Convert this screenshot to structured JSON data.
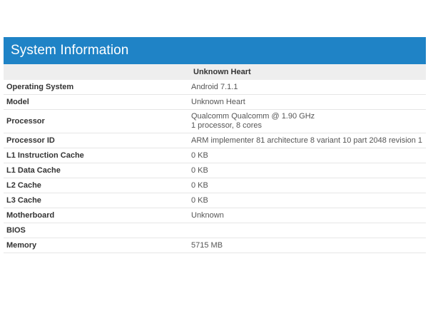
{
  "header": {
    "title": "System Information"
  },
  "device": {
    "name": "Unknown Heart"
  },
  "rows": [
    {
      "key": "Operating System",
      "value": "Android 7.1.1"
    },
    {
      "key": "Model",
      "value": "Unknown Heart"
    },
    {
      "key": "Processor",
      "value": "Qualcomm Qualcomm @ 1.90 GHz",
      "value2": "1 processor, 8 cores"
    },
    {
      "key": "Processor ID",
      "value": "ARM implementer 81 architecture 8 variant 10 part 2048 revision 1"
    },
    {
      "key": "L1 Instruction Cache",
      "value": "0 KB"
    },
    {
      "key": "L1 Data Cache",
      "value": "0 KB"
    },
    {
      "key": "L2 Cache",
      "value": "0 KB"
    },
    {
      "key": "L3 Cache",
      "value": "0 KB"
    },
    {
      "key": "Motherboard",
      "value": "Unknown"
    },
    {
      "key": "BIOS",
      "value": ""
    },
    {
      "key": "Memory",
      "value": "5715 MB"
    }
  ],
  "colors": {
    "header_bg": "#1f83c6",
    "header_text": "#ffffff",
    "subhead_bg": "#eeeeee"
  }
}
